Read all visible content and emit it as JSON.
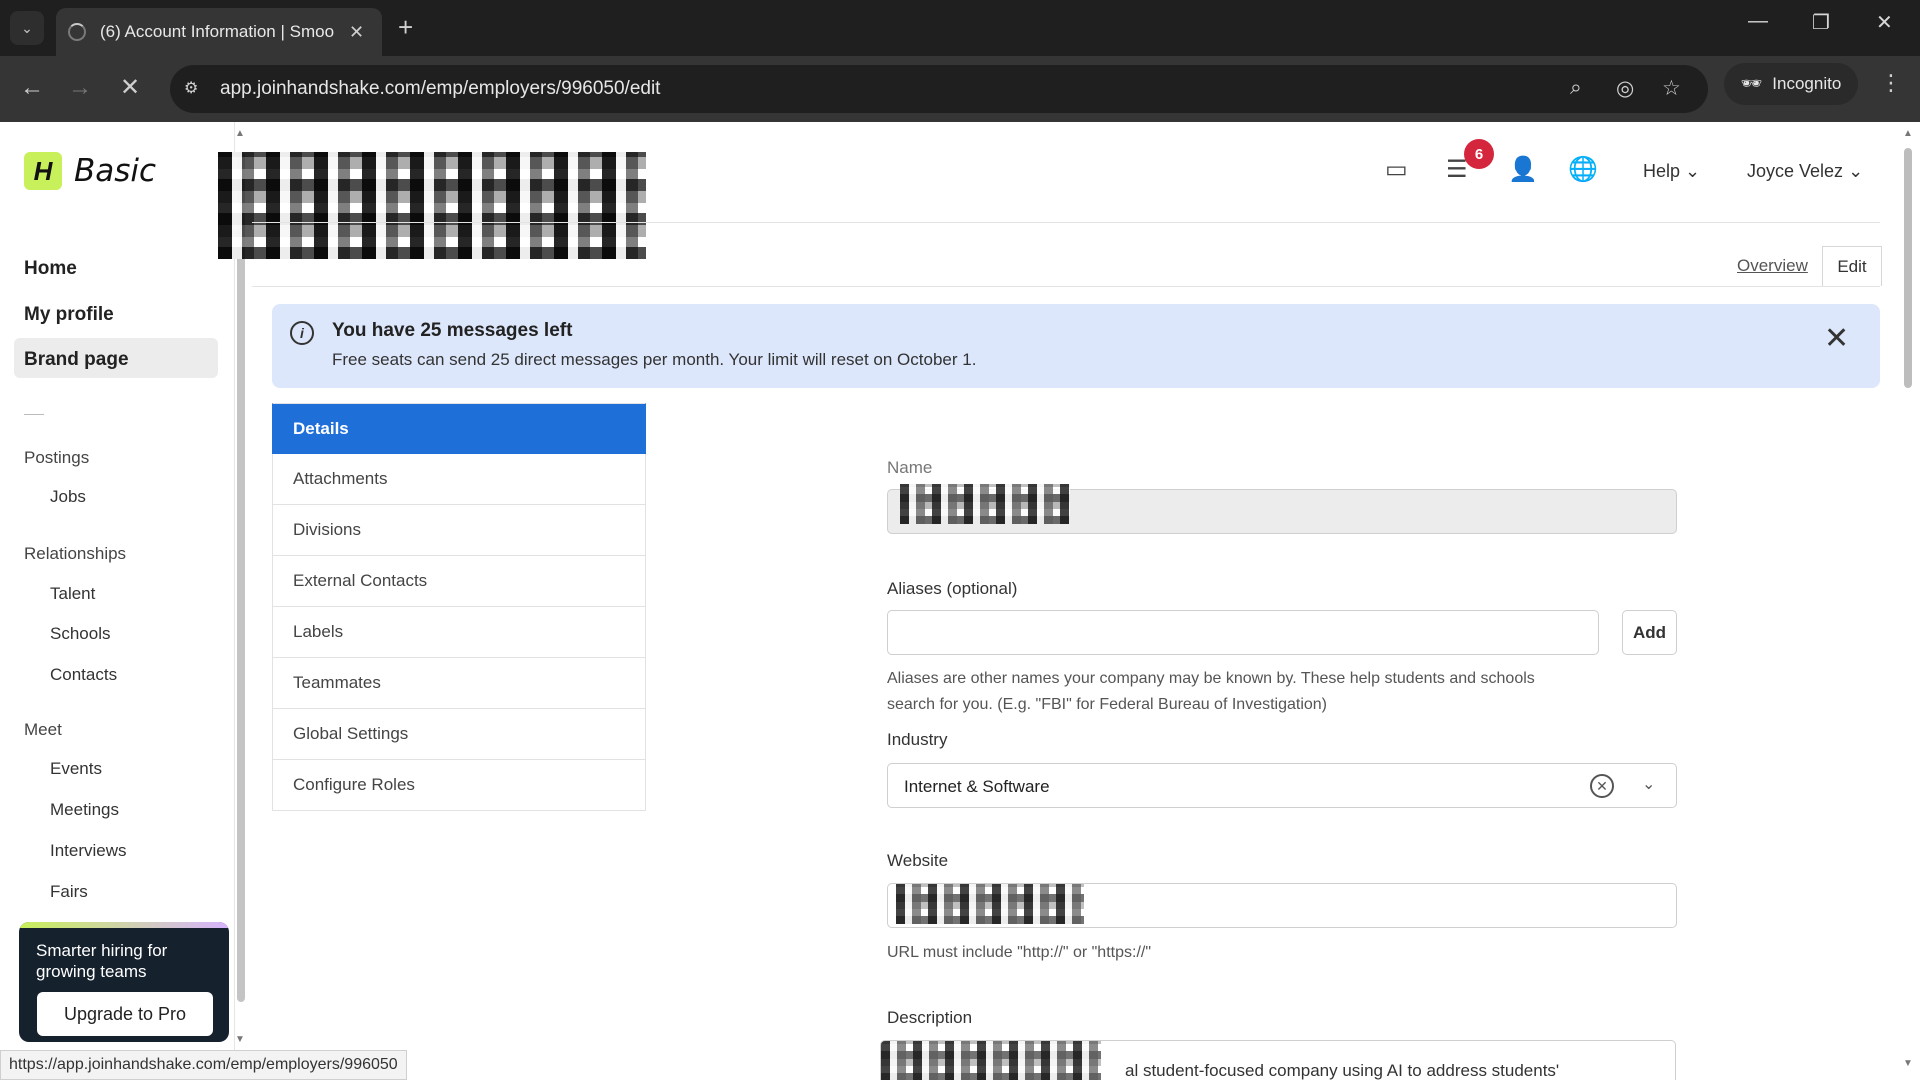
{
  "browser": {
    "tab_title": "(6) Account Information | Smoo",
    "url": "app.joinhandshake.com/emp/employers/996050/edit",
    "incognito_label": "Incognito",
    "status_url": "https://app.joinhandshake.com/emp/employers/996050"
  },
  "brand": {
    "logo_letter": "H",
    "plan": "Basic",
    "accent": "#c8f05a"
  },
  "sidebar": {
    "main": [
      {
        "label": "Home"
      },
      {
        "label": "My profile"
      },
      {
        "label": "Brand page"
      }
    ],
    "sections": {
      "postings": {
        "title": "Postings",
        "items": [
          "Jobs"
        ]
      },
      "relationships": {
        "title": "Relationships",
        "items": [
          "Talent",
          "Schools",
          "Contacts"
        ]
      },
      "meet": {
        "title": "Meet",
        "items": [
          "Events",
          "Meetings",
          "Interviews",
          "Fairs"
        ]
      }
    },
    "promo": {
      "text": "Smarter hiring for growing teams",
      "button": "Upgrade to Pro"
    }
  },
  "header": {
    "notification_count": "6",
    "help_label": "Help",
    "user_name": "Joyce Velez",
    "overview_label": "Overview",
    "edit_label": "Edit"
  },
  "banner": {
    "title": "You have 25 messages left",
    "text": "Free seats can send 25 direct messages per month. Your limit will reset on October 1.",
    "bg_color": "#dde7fb"
  },
  "tabs": [
    {
      "label": "Details",
      "active": true
    },
    {
      "label": "Attachments"
    },
    {
      "label": "Divisions"
    },
    {
      "label": "External Contacts"
    },
    {
      "label": "Labels"
    },
    {
      "label": "Teammates"
    },
    {
      "label": "Global Settings"
    },
    {
      "label": "Configure Roles"
    }
  ],
  "form": {
    "name_label": "Name",
    "aliases_label": "Aliases (optional)",
    "add_label": "Add",
    "aliases_help_1": "Aliases are other names your company may be known by. These help students and schools",
    "aliases_help_2": "search for you. (E.g. \"FBI\" for Federal Bureau of Investigation)",
    "industry_label": "Industry",
    "industry_value": "Internet & Software",
    "website_label": "Website",
    "website_help": "URL must include \"http://\" or \"https://\"",
    "description_label": "Description",
    "description_visible": "al student-focused company using AI to address students'"
  },
  "colors": {
    "active_tab": "#1f6fd9",
    "badge": "#d4263c"
  }
}
